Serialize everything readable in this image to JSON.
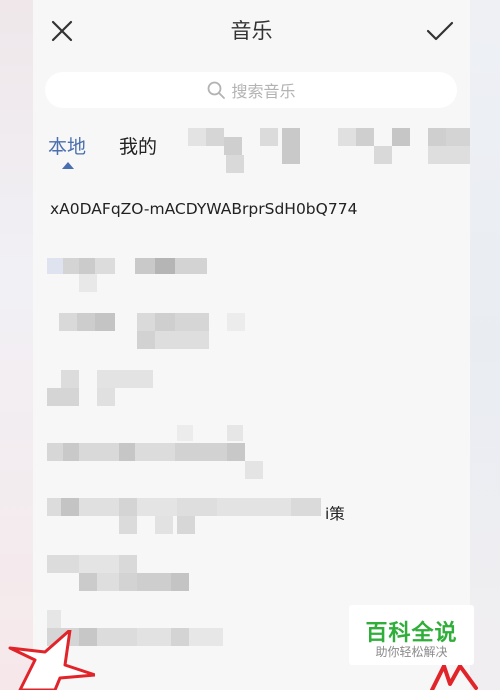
{
  "header": {
    "title": "音乐",
    "close_icon": "close-icon",
    "confirm_icon": "checkmark-icon"
  },
  "search": {
    "placeholder": "搜索音乐",
    "icon": "search-icon"
  },
  "tabs": [
    {
      "label": "本地",
      "active": true
    },
    {
      "label": "我的",
      "active": false
    }
  ],
  "songs": {
    "first": "xA0DAFqZO-mACDYWABrprSdH0bQ774",
    "partial_suffix": "i策"
  },
  "watermark": {
    "title": "百科全说",
    "subtitle": "助你轻松解决"
  },
  "colors": {
    "accent": "#4a6fb0",
    "watermark_green": "#2fae3a",
    "background": "#f7f7f7",
    "annotation_red": "#e0242a"
  }
}
